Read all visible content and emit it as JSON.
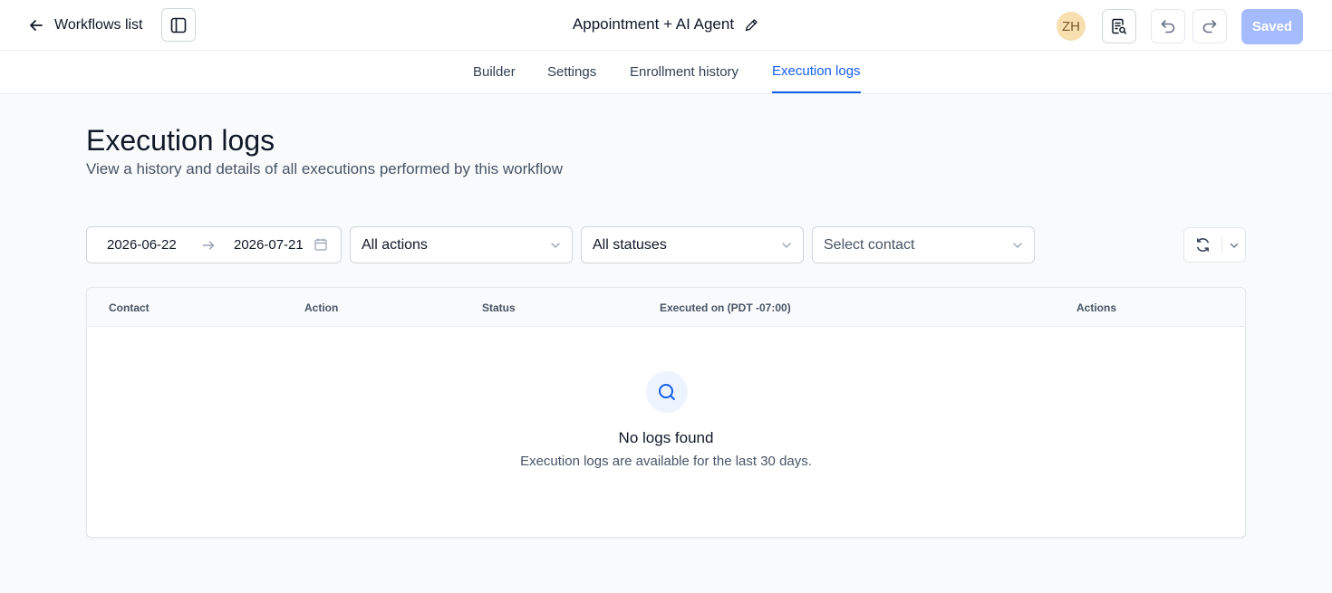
{
  "header": {
    "back_label": "Workflows list",
    "workflow_title": "Appointment + AI Agent",
    "avatar_initials": "ZH",
    "saved_label": "Saved"
  },
  "tabs": [
    {
      "label": "Builder",
      "active": false
    },
    {
      "label": "Settings",
      "active": false
    },
    {
      "label": "Enrollment history",
      "active": false
    },
    {
      "label": "Execution logs",
      "active": true
    }
  ],
  "page": {
    "title": "Execution logs",
    "subtitle": "View a history and details of all executions performed by this workflow"
  },
  "filters": {
    "date_start": "2026-06-22",
    "date_end": "2026-07-21",
    "actions_value": "All actions",
    "status_value": "All statuses",
    "contact_placeholder": "Select contact"
  },
  "table": {
    "columns": [
      "Contact",
      "Action",
      "Status",
      "Executed on (PDT -07:00)",
      "Actions"
    ],
    "rows": [],
    "empty_title": "No logs found",
    "empty_subtitle": "Execution logs are available for the last 30 days."
  },
  "colors": {
    "accent": "#155eef",
    "saved_button": "#a4bcfd",
    "avatar_bg": "#f8dfaf"
  },
  "icons": [
    "arrow-left-icon",
    "sidebar-panel-icon",
    "pencil-icon",
    "notes-icon",
    "undo-icon",
    "redo-icon",
    "calendar-icon",
    "chevron-down-icon",
    "refresh-icon",
    "search-icon"
  ]
}
